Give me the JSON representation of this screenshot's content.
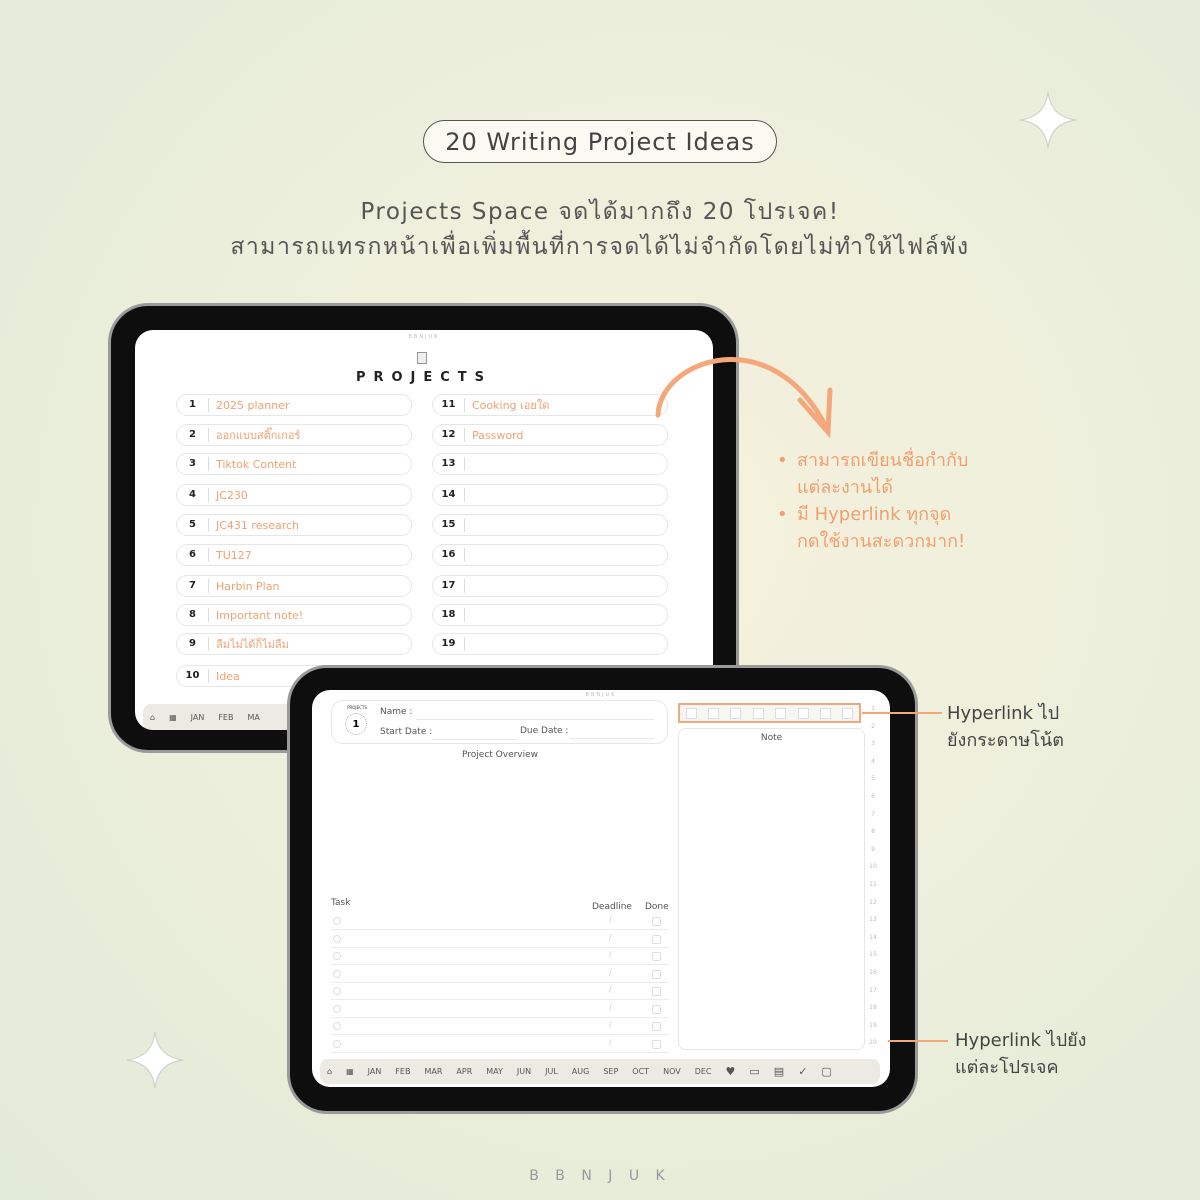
{
  "title": "20 Writing Project Ideas",
  "subtitle_line1": "Projects Space จดได้มากถึง 20 โปรเจค!",
  "subtitle_line2": "สามารถแทรกหน้าเพื่อเพิ่มพื้นที่การจดได้ไม่จำกัดโดยไม่ทำให้ไฟล์พัง",
  "accent_color": "#f0a070",
  "tablet1": {
    "brand": "BBNJUK",
    "heading": "PROJECTS",
    "projects": [
      {
        "num": "1",
        "name": "2025 planner"
      },
      {
        "num": "2",
        "name": "ออกแบบสติ๊กเกอร์"
      },
      {
        "num": "3",
        "name": "Tiktok Content"
      },
      {
        "num": "4",
        "name": "JC230"
      },
      {
        "num": "5",
        "name": "JC431 research"
      },
      {
        "num": "6",
        "name": "TU127"
      },
      {
        "num": "7",
        "name": "Harbin Plan"
      },
      {
        "num": "8",
        "name": "Important note!"
      },
      {
        "num": "9",
        "name": "ลืมไม่ได้ก็ไม่ลืม"
      },
      {
        "num": "10",
        "name": "Idea"
      },
      {
        "num": "11",
        "name": "Cooking เอยใด"
      },
      {
        "num": "12",
        "name": "Password"
      },
      {
        "num": "13",
        "name": ""
      },
      {
        "num": "14",
        "name": ""
      },
      {
        "num": "15",
        "name": ""
      },
      {
        "num": "16",
        "name": ""
      },
      {
        "num": "17",
        "name": ""
      },
      {
        "num": "18",
        "name": ""
      },
      {
        "num": "19",
        "name": ""
      }
    ],
    "nav": [
      "JAN",
      "FEB",
      "MA"
    ]
  },
  "tablet2": {
    "brand": "BBNJUK",
    "badge_label": "PROJECTS",
    "badge_num": "1",
    "name_label": "Name :",
    "start_label": "Start Date :",
    "due_label": "Due Date :",
    "overview_label": "Project Overview",
    "note_label": "Note",
    "task_label": "Task",
    "deadline_label": "Deadline",
    "done_label": "Done",
    "deadline_sep": "/",
    "line_numbers": [
      "1",
      "2",
      "3",
      "4",
      "5",
      "6",
      "7",
      "8",
      "9",
      "10",
      "11",
      "12",
      "13",
      "14",
      "15",
      "16",
      "17",
      "18",
      "19",
      "20"
    ],
    "months": [
      "JAN",
      "FEB",
      "MAR",
      "APR",
      "MAY",
      "JUN",
      "JUL",
      "AUG",
      "SEP",
      "OCT",
      "NOV",
      "DEC"
    ]
  },
  "annotations": {
    "bullet1": [
      "สามารถเขียนชื่อกำกับ",
      "แต่ละงานได้"
    ],
    "bullet2": [
      "มี Hyperlink ทุกจุด",
      "กดใช้งานสะดวกมาก!"
    ],
    "hyperlink1": [
      "Hyperlink ไป",
      "ยังกระดาษโน้ต"
    ],
    "hyperlink2": [
      "Hyperlink ไปยัง",
      "แต่ละโปรเจค"
    ]
  },
  "footer_brand": "B B N J U K"
}
